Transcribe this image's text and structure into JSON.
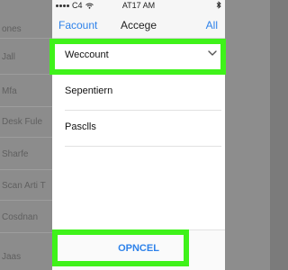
{
  "background_list": {
    "labels": [
      "ones",
      "Jall",
      "Mfa",
      "Desk Fule",
      "Sharfe",
      "Scan Arti T",
      "Cosdnan",
      "Jaas"
    ]
  },
  "status_bar": {
    "carrier": "C4",
    "time": "AT17 AM"
  },
  "nav": {
    "left_label": "Facount",
    "title": "Accege",
    "right_label": "All"
  },
  "options": [
    {
      "label": "Weccount",
      "selected": true
    },
    {
      "label": "Sepentiern",
      "selected": false
    },
    {
      "label": "Pasclls",
      "selected": false
    }
  ],
  "cancel_label": "OPNCEL",
  "colors": {
    "highlight": "#3ff21a",
    "accent": "#2e82ea",
    "dim_background": "#8c8c8c"
  }
}
